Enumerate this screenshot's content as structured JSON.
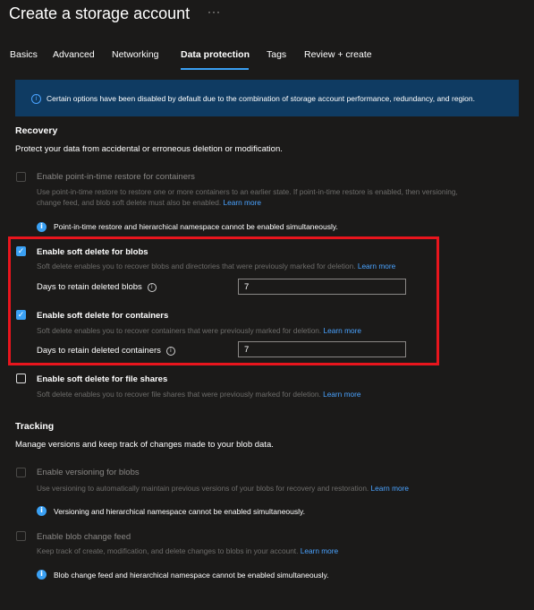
{
  "header": {
    "title": "Create a storage account",
    "more_label": "···"
  },
  "tabs": [
    "Basics",
    "Advanced",
    "Networking",
    "Data protection",
    "Tags",
    "Review + create"
  ],
  "active_tab": "Data protection",
  "banner": {
    "text": "Certain options have been disabled by default due to the combination of storage account performance, redundancy, and region."
  },
  "recovery": {
    "heading": "Recovery",
    "description": "Protect your data from accidental or erroneous deletion or modification.",
    "pitr": {
      "label": "Enable point-in-time restore for containers",
      "desc_line1": "Use point-in-time restore to restore one or more containers to an earlier state. If point-in-time restore is enabled, then versioning,",
      "desc_line2": "change feed, and blob soft delete must also be enabled.",
      "learn_more": "Learn more",
      "note": "Point-in-time restore and hierarchical namespace cannot be enabled simultaneously.",
      "checked": false
    },
    "soft_delete_blobs": {
      "label": "Enable soft delete for blobs",
      "desc": "Soft delete enables you to recover blobs and directories that were previously marked for deletion.",
      "learn_more": "Learn more",
      "days_label": "Days to retain deleted blobs",
      "days_value": "7",
      "checked": true
    },
    "soft_delete_containers": {
      "label": "Enable soft delete for containers",
      "desc": "Soft delete enables you to recover containers that were previously marked for deletion.",
      "learn_more": "Learn more",
      "days_label": "Days to retain deleted containers",
      "days_value": "7",
      "checked": true
    },
    "soft_delete_files": {
      "label": "Enable soft delete for file shares",
      "desc": "Soft delete enables you to recover file shares that were previously marked for deletion.",
      "learn_more": "Learn more",
      "checked": false
    }
  },
  "tracking": {
    "heading": "Tracking",
    "description": "Manage versions and keep track of changes made to your blob data.",
    "versioning": {
      "label": "Enable versioning for blobs",
      "desc": "Use versioning to automatically maintain previous versions of your blobs for recovery and restoration.",
      "learn_more": "Learn more",
      "note": "Versioning and hierarchical namespace cannot be enabled simultaneously.",
      "checked": false
    },
    "change_feed": {
      "label": "Enable blob change feed",
      "desc": "Keep track of create, modification, and delete changes to blobs in your account.",
      "learn_more": "Learn more",
      "note": "Blob change feed and hierarchical namespace cannot be enabled simultaneously.",
      "checked": false
    }
  },
  "colors": {
    "background": "#1b1a19",
    "accent": "#3aa0f3",
    "link": "#4aa3ff",
    "banner": "#0f3b62",
    "highlight": "#e8151d"
  },
  "icons": {
    "info": "info-icon",
    "check": "checkmark-icon"
  }
}
